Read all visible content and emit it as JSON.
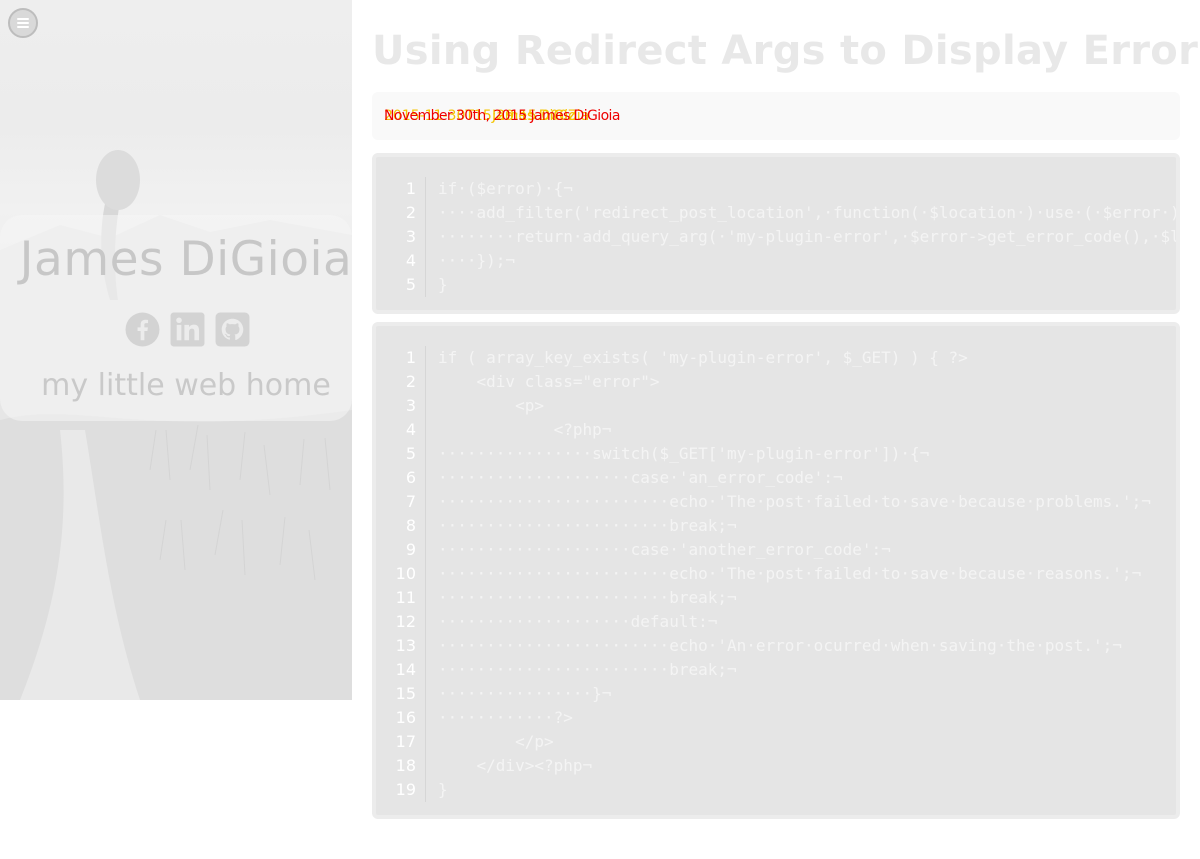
{
  "sidebar": {
    "menu_icon": "hamburger-menu-icon",
    "name": "James DiGioia",
    "tagline": "my little web home",
    "socials": [
      {
        "icon": "facebook-icon"
      },
      {
        "icon": "linkedin-icon"
      },
      {
        "icon": "github-icon"
      }
    ]
  },
  "post": {
    "title": "Using Redirect Args to Display Errors",
    "meta_date": "2015-11-30T15:29:15.000Z",
    "meta_date_label": "November 30th, 2015",
    "meta_author": "James DiGioia",
    "meta_colors": {
      "date": "#f5c400",
      "overlay": "#ee0000"
    }
  },
  "code_blocks": [
    {
      "lines": [
        {
          "n": "1",
          "text": "if·($error)·{¬"
        },
        {
          "n": "2",
          "text": "····add_filter('redirect_post_location',·function(·$location·)·use·(·$error·)"
        },
        {
          "n": "3",
          "text": "········return·add_query_arg(·'my-plugin-error',·$error->get_error_code(),·$l"
        },
        {
          "n": "4",
          "text": "····});¬"
        },
        {
          "n": "5",
          "text": "}"
        }
      ]
    },
    {
      "lines": [
        {
          "n": "1",
          "text": "if ( array_key_exists( 'my-plugin-error', $_GET) ) { ?>"
        },
        {
          "n": "2",
          "text": "    <div class=\"error\">"
        },
        {
          "n": "3",
          "text": "        <p>"
        },
        {
          "n": "4",
          "text": "            <?php¬"
        },
        {
          "n": "5",
          "text": "················switch($_GET['my-plugin-error'])·{¬"
        },
        {
          "n": "6",
          "text": "····················case·'an_error_code':¬"
        },
        {
          "n": "7",
          "text": "························echo·'The·post·failed·to·save·because·problems.';¬"
        },
        {
          "n": "8",
          "text": "························break;¬"
        },
        {
          "n": "9",
          "text": "····················case·'another_error_code':¬"
        },
        {
          "n": "10",
          "text": "························echo·'The·post·failed·to·save·because·reasons.';¬"
        },
        {
          "n": "11",
          "text": "························break;¬"
        },
        {
          "n": "12",
          "text": "····················default:¬"
        },
        {
          "n": "13",
          "text": "························echo·'An·error·ocurred·when·saving·the·post.';¬"
        },
        {
          "n": "14",
          "text": "························break;¬"
        },
        {
          "n": "15",
          "text": "················}¬"
        },
        {
          "n": "16",
          "text": "············?>"
        },
        {
          "n": "17",
          "text": "        </p>"
        },
        {
          "n": "18",
          "text": "    </div><?php¬"
        },
        {
          "n": "19",
          "text": "}"
        }
      ]
    }
  ]
}
